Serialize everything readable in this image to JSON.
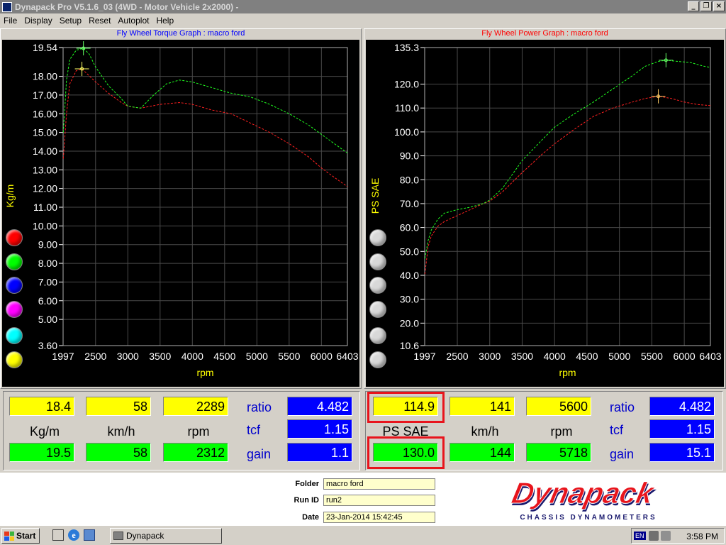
{
  "window": {
    "title": "Dynapack Pro V5.1.6_03 (4WD - Motor Vehicle 2x2000) -",
    "buttons": {
      "minimize": "_",
      "restore": "❐",
      "close": "×"
    }
  },
  "menu": [
    "File",
    "Display",
    "Setup",
    "Reset",
    "Autoplot",
    "Help"
  ],
  "colors": {
    "run_red": "#ff2020",
    "run_green": "#20ff20",
    "axis_text": "#ffffff",
    "unit_text": "#ffff00",
    "torque_title": "#0000ff",
    "power_title": "#ff0000",
    "highlight": "#e8141c"
  },
  "run_selectors_left": [
    "#ff0000",
    "#00ff00",
    "#0000ff",
    "#ff00ff",
    "#00ffff",
    "#ffff00"
  ],
  "run_selectors_right": [
    "#d8d8d8",
    "#d8d8d8",
    "#d8d8d8",
    "#d8d8d8",
    "#d8d8d8",
    "#d8d8d8"
  ],
  "chart_data": [
    {
      "type": "line",
      "title": "Fly Wheel Torque Graph : macro ford",
      "xlabel": "rpm",
      "ylabel": "Kg/m",
      "xlim": [
        1997,
        6403
      ],
      "ylim": [
        3.6,
        19.54
      ],
      "x_ticks": [
        "1997",
        "2500",
        "3000",
        "3500",
        "4000",
        "4500",
        "5000",
        "5500",
        "6000",
        "6403"
      ],
      "y_ticks": [
        "19.54",
        "18.00",
        "17.00",
        "16.00",
        "15.00",
        "14.00",
        "13.00",
        "12.00",
        "11.00",
        "10.00",
        "9.00",
        "8.00",
        "7.00",
        "6.00",
        "5.00",
        "3.60"
      ],
      "y_tick_values": [
        19.54,
        18,
        17,
        16,
        15,
        14,
        13,
        12,
        11,
        10,
        9,
        8,
        7,
        6,
        5,
        3.6
      ],
      "grid": true,
      "series": [
        {
          "color": "#ff2020",
          "x": [
            2000,
            2050,
            2100,
            2200,
            2289,
            2350,
            2500,
            2700,
            2900,
            3000,
            3200,
            3500,
            3800,
            4000,
            4300,
            4600,
            4900,
            5200,
            5500,
            5800,
            6000,
            6200,
            6403
          ],
          "y": [
            13.6,
            16.0,
            17.6,
            18.3,
            18.4,
            18.2,
            17.7,
            17.1,
            16.6,
            16.4,
            16.3,
            16.5,
            16.6,
            16.5,
            16.2,
            16.0,
            15.5,
            15.0,
            14.4,
            13.7,
            13.1,
            12.6,
            12.1
          ]
        },
        {
          "color": "#20ff20",
          "x": [
            2000,
            2050,
            2100,
            2200,
            2312,
            2400,
            2500,
            2700,
            2900,
            3000,
            3200,
            3400,
            3600,
            3800,
            4000,
            4300,
            4600,
            4900,
            5200,
            5500,
            5800,
            6000,
            6200,
            6403
          ],
          "y": [
            15.0,
            17.8,
            18.9,
            19.4,
            19.5,
            19.2,
            18.5,
            17.5,
            16.8,
            16.4,
            16.3,
            17.0,
            17.6,
            17.8,
            17.7,
            17.4,
            17.1,
            16.9,
            16.5,
            16.0,
            15.4,
            14.9,
            14.4,
            13.9
          ]
        }
      ],
      "markers": [
        {
          "color": "#ffff66",
          "x": 2289,
          "y": 18.4
        },
        {
          "color": "#66ff66",
          "x": 2312,
          "y": 19.5
        }
      ]
    },
    {
      "type": "line",
      "title": "Fly Wheel Power Graph : macro ford",
      "xlabel": "rpm",
      "ylabel": "PS SAE",
      "xlim": [
        1997,
        6403
      ],
      "ylim": [
        10.6,
        135.3
      ],
      "x_ticks": [
        "1997",
        "2500",
        "3000",
        "3500",
        "4000",
        "4500",
        "5000",
        "5500",
        "6000",
        "6403"
      ],
      "y_ticks": [
        "135.3",
        "120.0",
        "110.0",
        "100.0",
        "90.0",
        "80.0",
        "70.0",
        "60.0",
        "50.0",
        "40.0",
        "30.0",
        "20.0",
        "10.6"
      ],
      "y_tick_values": [
        135.3,
        120,
        110,
        100,
        90,
        80,
        70,
        60,
        50,
        40,
        30,
        20,
        10.6
      ],
      "grid": true,
      "series": [
        {
          "color": "#ff2020",
          "x": [
            2000,
            2050,
            2100,
            2200,
            2300,
            2500,
            2700,
            2900,
            3000,
            3200,
            3500,
            3800,
            4000,
            4300,
            4600,
            4900,
            5200,
            5400,
            5600,
            5800,
            6000,
            6200,
            6403
          ],
          "y": [
            40.5,
            52.0,
            56.5,
            60.5,
            62.5,
            65.0,
            67.5,
            70.0,
            71.0,
            75.0,
            83.0,
            90.5,
            95.0,
            101.0,
            106.5,
            110.0,
            112.5,
            114.0,
            114.9,
            114.0,
            112.5,
            111.5,
            111.0
          ]
        },
        {
          "color": "#20ff20",
          "x": [
            2000,
            2050,
            2100,
            2200,
            2300,
            2500,
            2700,
            2900,
            3000,
            3200,
            3500,
            3800,
            4000,
            4300,
            4600,
            4900,
            5200,
            5400,
            5600,
            5718,
            5900,
            6100,
            6300,
            6403
          ],
          "y": [
            47.0,
            54.5,
            59.0,
            63.5,
            66.0,
            67.5,
            68.5,
            70.0,
            71.5,
            76.5,
            88.0,
            96.5,
            102.0,
            107.5,
            112.5,
            118.0,
            123.5,
            127.5,
            129.5,
            130.0,
            129.5,
            129.0,
            127.5,
            127.0
          ]
        }
      ],
      "markers": [
        {
          "color": "#ffcc66",
          "x": 5600,
          "y": 114.9
        },
        {
          "color": "#66ff66",
          "x": 5718,
          "y": 130.0
        }
      ]
    }
  ],
  "readout_left": {
    "row1": [
      "18.4",
      "58",
      "2289"
    ],
    "units": [
      "Kg/m",
      "km/h",
      "rpm"
    ],
    "row2": [
      "19.5",
      "58",
      "2312"
    ],
    "labels": [
      "ratio",
      "tcf",
      "gain"
    ],
    "blue": [
      "4.482",
      "1.15",
      "1.1"
    ]
  },
  "readout_right": {
    "row1": [
      "114.9",
      "141",
      "5600"
    ],
    "units": [
      "PS SAE",
      "km/h",
      "rpm"
    ],
    "row2": [
      "130.0",
      "144",
      "5718"
    ],
    "labels": [
      "ratio",
      "tcf",
      "gain"
    ],
    "blue": [
      "4.482",
      "1.15",
      "15.1"
    ]
  },
  "info": {
    "folder_label": "Folder",
    "folder_value": "macro ford",
    "runid_label": "Run ID",
    "runid_value": "run2",
    "date_label": "Date",
    "date_value": "23-Jan-2014  15:42:45"
  },
  "logo": {
    "brand": "Dynapack",
    "tagline": "CHASSIS   DYNAMOMETERS",
    "red": "#e8141c",
    "navy": "#1a1a6e"
  },
  "taskbar": {
    "start": "Start",
    "task": "Dynapack",
    "lang": "EN",
    "clock": "3:58 PM"
  }
}
